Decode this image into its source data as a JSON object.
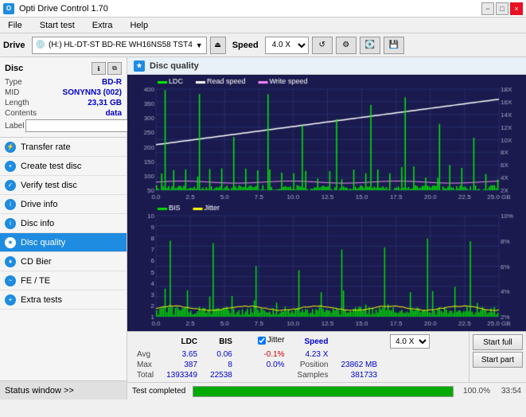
{
  "titleBar": {
    "title": "Opti Drive Control 1.70",
    "iconLabel": "O",
    "buttons": [
      "−",
      "□",
      "×"
    ]
  },
  "menuBar": {
    "items": [
      "File",
      "Start test",
      "Extra",
      "Help"
    ]
  },
  "toolbar": {
    "driveLabel": "Drive",
    "driveName": "(H:)  HL-DT-ST BD-RE  WH16NS58 TST4",
    "speedLabel": "Speed",
    "speedValue": "4.0 X"
  },
  "sidebar": {
    "discSection": {
      "title": "Disc",
      "rows": [
        {
          "label": "Type",
          "value": "BD-R",
          "colorClass": "blue"
        },
        {
          "label": "MID",
          "value": "SONYNN3 (002)",
          "colorClass": "blue"
        },
        {
          "label": "Length",
          "value": "23,31 GB",
          "colorClass": "blue"
        },
        {
          "label": "Contents",
          "value": "data",
          "colorClass": "blue"
        }
      ],
      "labelField": {
        "label": "Label",
        "placeholder": ""
      }
    },
    "navItems": [
      {
        "id": "transfer-rate",
        "label": "Transfer rate",
        "active": false
      },
      {
        "id": "create-test-disc",
        "label": "Create test disc",
        "active": false
      },
      {
        "id": "verify-test-disc",
        "label": "Verify test disc",
        "active": false
      },
      {
        "id": "drive-info",
        "label": "Drive info",
        "active": false
      },
      {
        "id": "disc-info",
        "label": "Disc info",
        "active": false
      },
      {
        "id": "disc-quality",
        "label": "Disc quality",
        "active": true
      },
      {
        "id": "cd-bier",
        "label": "CD Bier",
        "active": false
      },
      {
        "id": "fe-te",
        "label": "FE / TE",
        "active": false
      },
      {
        "id": "extra-tests",
        "label": "Extra tests",
        "active": false
      }
    ],
    "statusWindow": "Status window >>"
  },
  "discQuality": {
    "title": "Disc quality",
    "chart1": {
      "legend": [
        {
          "label": "LDC",
          "color": "#00ff00"
        },
        {
          "label": "Read speed",
          "color": "#ffffff"
        },
        {
          "label": "Write speed",
          "color": "#ff88ff"
        }
      ],
      "yAxisMax": 400,
      "yAxisLabels": [
        "400",
        "350",
        "300",
        "250",
        "200",
        "150",
        "100",
        "50"
      ],
      "yAxisRight": [
        "18X",
        "16X",
        "14X",
        "12X",
        "10X",
        "8X",
        "6X",
        "4X",
        "2X"
      ],
      "xAxisLabels": [
        "0.0",
        "2.5",
        "5.0",
        "7.5",
        "10.0",
        "12.5",
        "15.0",
        "17.5",
        "20.0",
        "22.5",
        "25.0 GB"
      ]
    },
    "chart2": {
      "legend": [
        {
          "label": "BIS",
          "color": "#00ff00"
        },
        {
          "label": "Jitter",
          "color": "#ffff00"
        }
      ],
      "yAxisMax": 10,
      "yAxisLabels": [
        "10",
        "9",
        "8",
        "7",
        "6",
        "5",
        "4",
        "3",
        "2",
        "1"
      ],
      "yAxisRight": [
        "10%",
        "8%",
        "6%",
        "4%",
        "2%"
      ],
      "xAxisLabels": [
        "0.0",
        "2.5",
        "5.0",
        "7.5",
        "10.0",
        "12.5",
        "15.0",
        "17.5",
        "20.0",
        "22.5",
        "25.0 GB"
      ]
    },
    "stats": {
      "headers": [
        "LDC",
        "BIS",
        "",
        "Jitter",
        "Speed",
        ""
      ],
      "rows": [
        {
          "label": "Avg",
          "ldc": "3.65",
          "bis": "0.06",
          "jitter": "-0.1%",
          "speed": "4.23 X",
          "speedSelect": "4.0 X"
        },
        {
          "label": "Max",
          "ldc": "387",
          "bis": "8",
          "jitter": "0.0%",
          "position": "23862 MB"
        },
        {
          "label": "Total",
          "ldc": "1393349",
          "bis": "22538",
          "samples": "381733"
        }
      ]
    },
    "buttons": {
      "startFull": "Start full",
      "startPart": "Start part"
    },
    "jitterCheckbox": {
      "checked": true,
      "label": "Jitter"
    }
  },
  "progressBar": {
    "percent": 100,
    "percentText": "100.0%",
    "statusText": "Test completed",
    "timeText": "33:54"
  }
}
